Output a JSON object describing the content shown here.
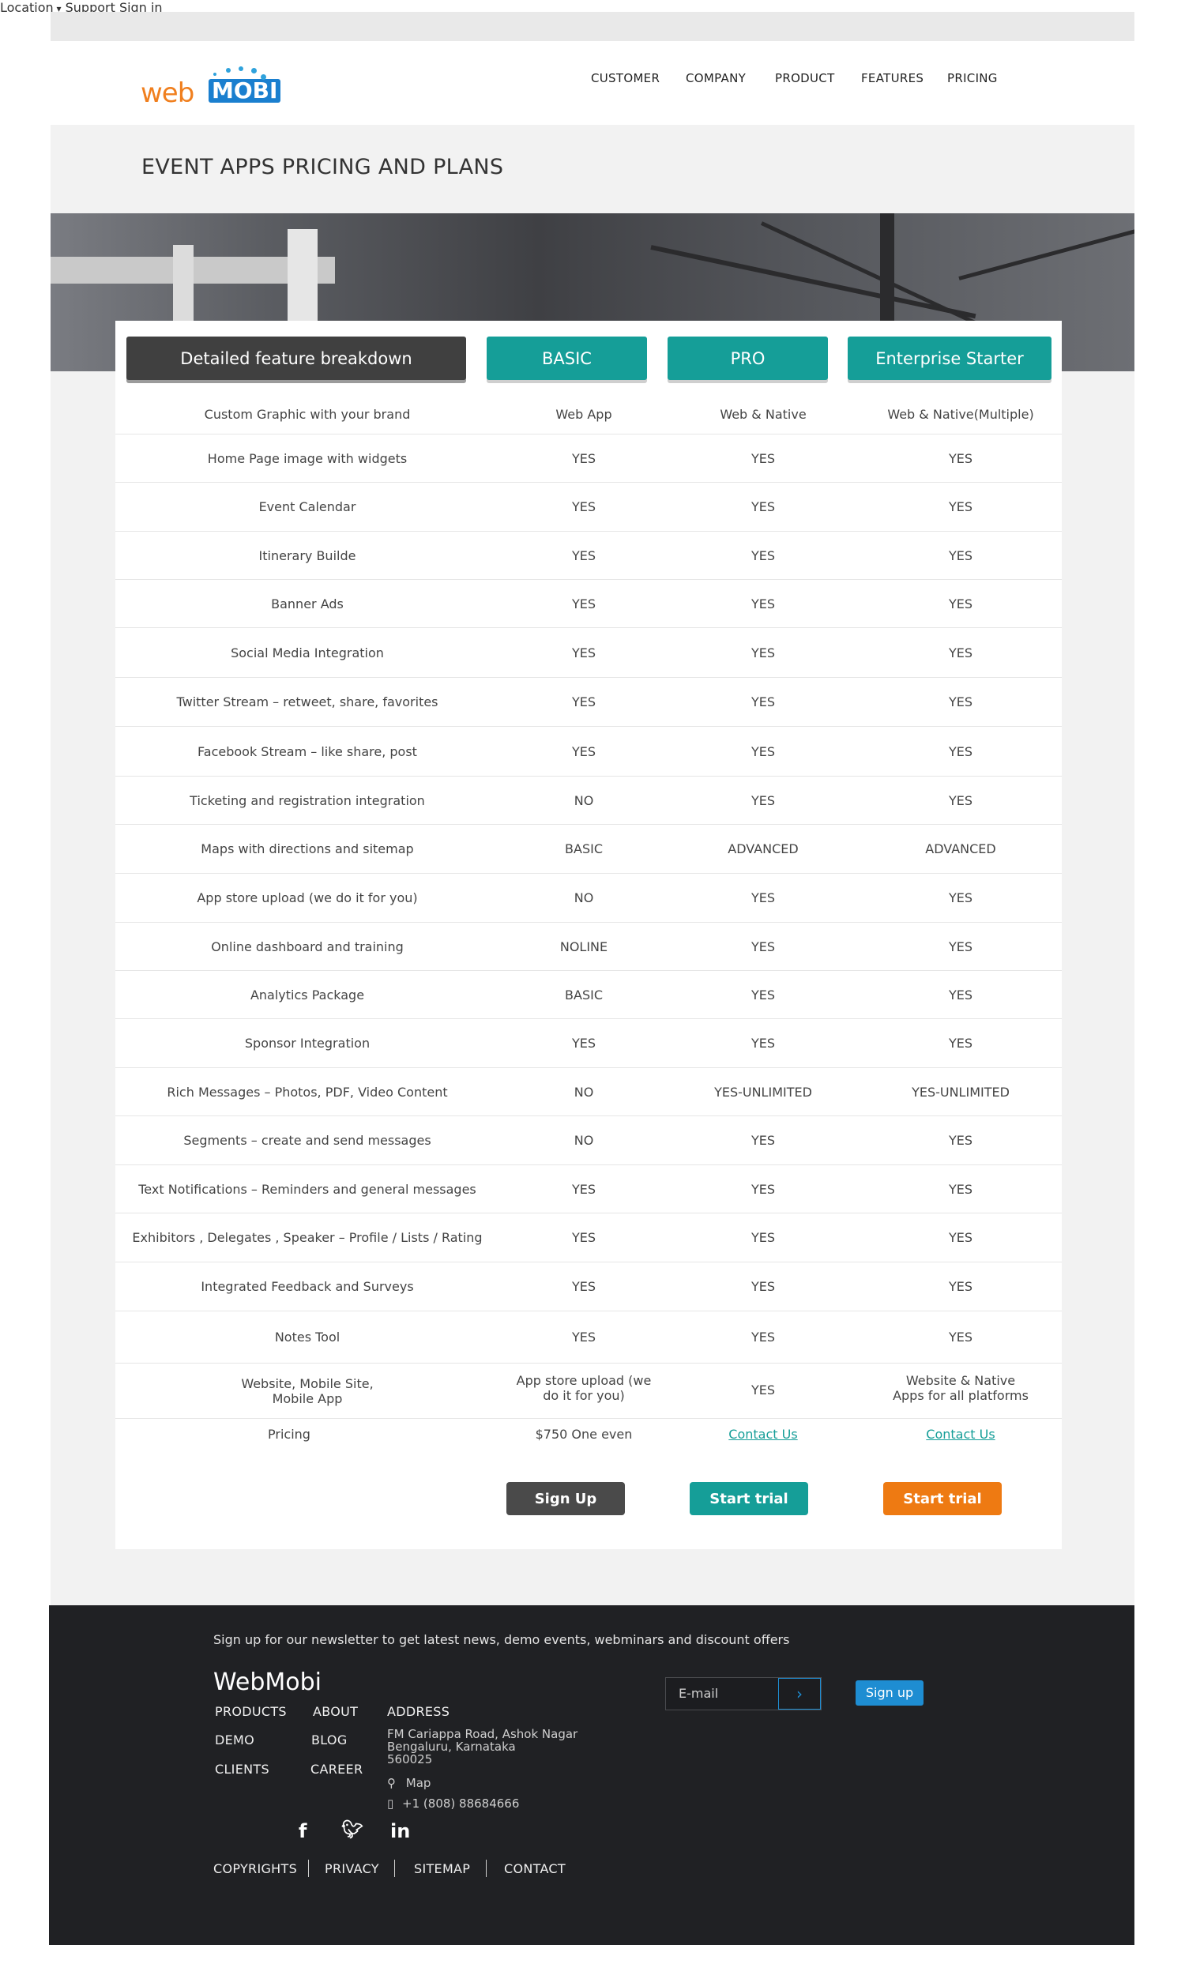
{
  "topbar": {
    "location": "Location",
    "support": "Support",
    "signin": "Sign in"
  },
  "logo": {
    "web": "web",
    "mobi": "MOBI"
  },
  "nav": [
    "CUSTOMER",
    "COMPANY",
    "PRODUCT",
    "FEATURES",
    "PRICING"
  ],
  "page_title": "EVENT APPS PRICING AND PLANS",
  "table": {
    "headers": [
      "Detailed feature breakdown",
      "BASIC",
      "PRO",
      "Enterprise Starter"
    ],
    "rows": [
      [
        "Custom Graphic with your brand",
        "Web App",
        "Web & Native",
        "Web & Native(Multiple)"
      ],
      [
        "Home Page image with widgets",
        "YES",
        "YES",
        "YES"
      ],
      [
        "Event Calendar",
        "YES",
        "YES",
        "YES"
      ],
      [
        "Itinerary Builde",
        "YES",
        "YES",
        "YES"
      ],
      [
        "Banner Ads",
        "YES",
        "YES",
        "YES"
      ],
      [
        "Social Media Integration",
        "YES",
        "YES",
        "YES"
      ],
      [
        "Twitter Stream – retweet, share, favorites",
        "YES",
        "YES",
        "YES"
      ],
      [
        "Facebook Stream – like share, post",
        "YES",
        "YES",
        "YES"
      ],
      [
        "Ticketing and registration integration",
        "NO",
        "YES",
        "YES"
      ],
      [
        "Maps with directions and sitemap",
        "BASIC",
        "ADVANCED",
        "ADVANCED"
      ],
      [
        "App store upload (we do it for you)",
        "NO",
        "YES",
        "YES"
      ],
      [
        "Online dashboard and training",
        "NOLINE",
        "YES",
        "YES"
      ],
      [
        "Analytics Package",
        "BASIC",
        "YES",
        "YES"
      ],
      [
        "Sponsor Integration",
        "YES",
        "YES",
        "YES"
      ],
      [
        "Rich Messages – Photos, PDF, Video Content",
        "NO",
        "YES-UNLIMITED",
        "YES-UNLIMITED"
      ],
      [
        "Segments – create and send messages",
        "NO",
        "YES",
        "YES"
      ],
      [
        "Text Notifications – Reminders and general messages",
        "YES",
        "YES",
        "YES"
      ],
      [
        "Exhibitors , Delegates , Speaker – Profile / Lists / Rating",
        "YES",
        "YES",
        "YES"
      ],
      [
        "Integrated Feedback and Surveys",
        "YES",
        "YES",
        "YES"
      ],
      [
        "Notes Tool",
        "YES",
        "YES",
        "YES"
      ]
    ],
    "website_row": {
      "feature_line1": "Website, Mobile Site,",
      "feature_line2": "Mobile App",
      "basic_line1": "App store upload (we",
      "basic_line2": "do it for you)",
      "pro": "YES",
      "ent_line1": "Website & Native",
      "ent_line2": "Apps for all platforms"
    },
    "pricing_row": {
      "label": "Pricing",
      "basic": "$750 One even",
      "pro": "Contact Us",
      "ent": "Contact Us"
    },
    "buttons": {
      "basic": "Sign Up",
      "pro": "Start trial",
      "ent": "Start trial"
    }
  },
  "colors": {
    "teal": "#159e98",
    "dark_button": "#4a4a4a",
    "orange": "#ee7a12",
    "footer_bg": "#202124",
    "blue": "#1e8dd2"
  },
  "footer": {
    "newsletter": "Sign up for our newsletter to get latest news, demo events, webminars and discount offers",
    "brand": "WebMobi",
    "col1": [
      "PRODUCTS",
      "DEMO",
      "CLIENTS"
    ],
    "col2": [
      "ABOUT",
      "BLOG",
      "CAREER"
    ],
    "address_title": "ADDRESS",
    "address_lines": [
      "FM Cariappa Road, Ashok Nagar",
      "Bengaluru, Karnataka",
      "560025"
    ],
    "map": "Map",
    "phone": "+1 (808) 88684666",
    "email_placeholder": "E-mail",
    "signup": "Sign up",
    "bottom_links": [
      "COPYRIGHTS",
      "PRIVACY",
      "SITEMAP",
      "CONTACT"
    ]
  }
}
